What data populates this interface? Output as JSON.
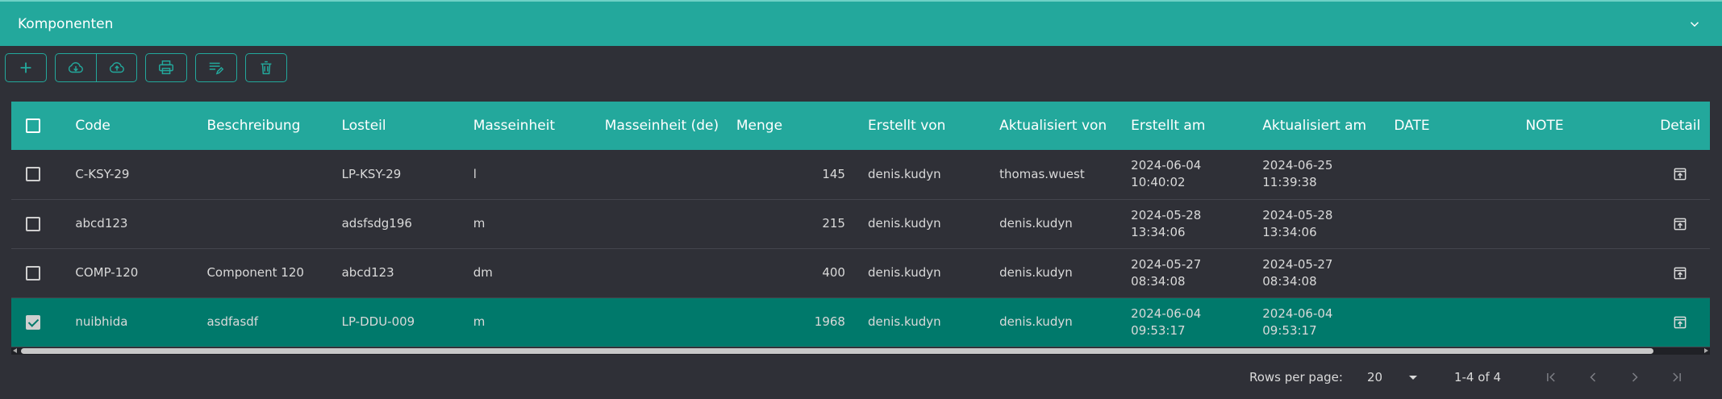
{
  "panel": {
    "title": "Komponenten"
  },
  "table": {
    "headers": {
      "code": "Code",
      "beschreibung": "Beschreibung",
      "losteil": "Losteil",
      "masseinheit": "Masseinheit",
      "masseinheit_de": "Masseinheit (de)",
      "menge": "Menge",
      "erstellt_von": "Erstellt von",
      "aktualisiert_von": "Aktualisiert von",
      "erstellt_am": "Erstellt am",
      "aktualisiert_am": "Aktualisiert am",
      "date": "DATE",
      "note": "NOTE",
      "detail": "Detail"
    },
    "rows": [
      {
        "code": "C-KSY-29",
        "beschreibung": "",
        "losteil": "LP-KSY-29",
        "masseinheit": "l",
        "masseinheit_de": "",
        "menge": "145",
        "erstellt_von": "denis.kudyn",
        "aktualisiert_von": "thomas.wuest",
        "erstellt_am_date": "2024-06-04",
        "erstellt_am_time": "10:40:02",
        "aktualisiert_am_date": "2024-06-25",
        "aktualisiert_am_time": "11:39:38",
        "date": "",
        "note": "",
        "selected": false
      },
      {
        "code": "abcd123",
        "beschreibung": "",
        "losteil": "adsfsdg196",
        "masseinheit": "m",
        "masseinheit_de": "",
        "menge": "215",
        "erstellt_von": "denis.kudyn",
        "aktualisiert_von": "denis.kudyn",
        "erstellt_am_date": "2024-05-28",
        "erstellt_am_time": "13:34:06",
        "aktualisiert_am_date": "2024-05-28",
        "aktualisiert_am_time": "13:34:06",
        "date": "",
        "note": "",
        "selected": false
      },
      {
        "code": "COMP-120",
        "beschreibung": "Component 120",
        "losteil": "abcd123",
        "masseinheit": "dm",
        "masseinheit_de": "",
        "menge": "400",
        "erstellt_von": "denis.kudyn",
        "aktualisiert_von": "denis.kudyn",
        "erstellt_am_date": "2024-05-27",
        "erstellt_am_time": "08:34:08",
        "aktualisiert_am_date": "2024-05-27",
        "aktualisiert_am_time": "08:34:08",
        "date": "",
        "note": "",
        "selected": false
      },
      {
        "code": "nuibhida",
        "beschreibung": "asdfasdf",
        "losteil": "LP-DDU-009",
        "masseinheit": "m",
        "masseinheit_de": "",
        "menge": "1968",
        "erstellt_von": "denis.kudyn",
        "aktualisiert_von": "denis.kudyn",
        "erstellt_am_date": "2024-06-04",
        "erstellt_am_time": "09:53:17",
        "aktualisiert_am_date": "2024-06-04",
        "aktualisiert_am_time": "09:53:17",
        "date": "",
        "note": "",
        "selected": true
      }
    ]
  },
  "paginator": {
    "rows_per_page_label": "Rows per page:",
    "rows_per_page_value": "20",
    "range": "1-4 of 4"
  },
  "colors": {
    "accent": "#23a89c",
    "selected_row": "#00796b",
    "background": "#2f3037"
  }
}
